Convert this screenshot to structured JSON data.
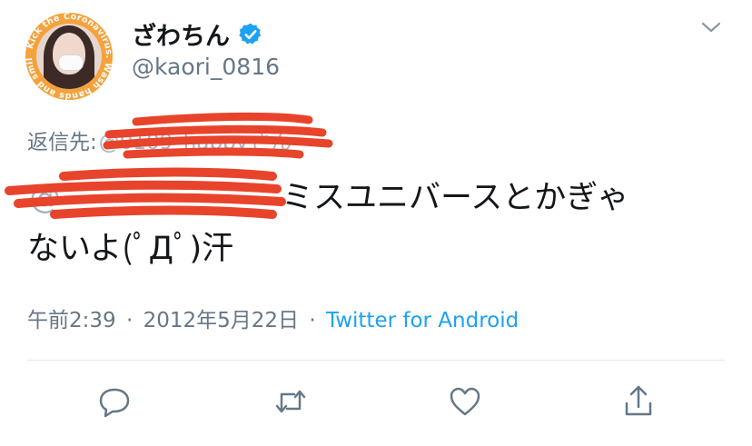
{
  "profile": {
    "display_name": "ざわちん",
    "handle": "@kaori_0816",
    "avatar_ring_text": "Kick the Coronavirus. Wash hands and smile",
    "verified": true
  },
  "tweet": {
    "reply_to_label": "返信先:",
    "reply_to_handle": "@0109_happy",
    "reply_to_suffix": "さん",
    "mention": "@",
    "text_line1": "ミスユニバースとかぎゃ",
    "text_line2": "ないよ(ﾟДﾟ)汗",
    "time": "午前2:39",
    "separator": "·",
    "date": "2012年5月22日",
    "source": "Twitter for Android"
  },
  "actions": [
    {
      "icon": "reply-icon"
    },
    {
      "icon": "retweet-icon"
    },
    {
      "icon": "like-icon"
    },
    {
      "icon": "share-icon"
    }
  ],
  "colors": {
    "text": "#14171a",
    "secondary": "#657786",
    "link": "#1da1f2",
    "verified": "#1da1f2",
    "redaction": "#e8442c",
    "avatar_ring": "#f5a23c"
  }
}
